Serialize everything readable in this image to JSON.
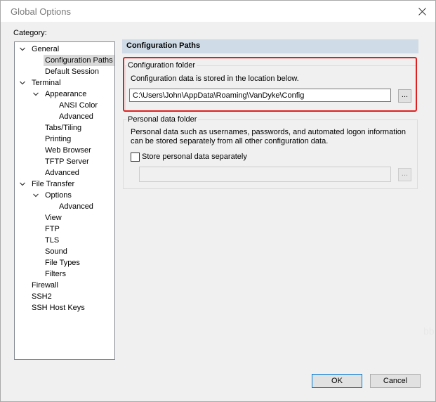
{
  "window": {
    "title": "Global Options"
  },
  "category_label": "Category:",
  "tree": {
    "items": [
      {
        "label": "General",
        "level": 0,
        "expanded": true
      },
      {
        "label": "Configuration Paths",
        "level": 1,
        "selected": true
      },
      {
        "label": "Default Session",
        "level": 1
      },
      {
        "label": "Terminal",
        "level": 0,
        "expanded": true
      },
      {
        "label": "Appearance",
        "level": 1,
        "expanded": true
      },
      {
        "label": "ANSI Color",
        "level": 2
      },
      {
        "label": "Advanced",
        "level": 2
      },
      {
        "label": "Tabs/Tiling",
        "level": 1
      },
      {
        "label": "Printing",
        "level": 1
      },
      {
        "label": "Web Browser",
        "level": 1
      },
      {
        "label": "TFTP Server",
        "level": 1
      },
      {
        "label": "Advanced",
        "level": 1
      },
      {
        "label": "File Transfer",
        "level": 0,
        "expanded": true
      },
      {
        "label": "Options",
        "level": 1,
        "expanded": true
      },
      {
        "label": "Advanced",
        "level": 2
      },
      {
        "label": "View",
        "level": 1
      },
      {
        "label": "FTP",
        "level": 1
      },
      {
        "label": "TLS",
        "level": 1
      },
      {
        "label": "Sound",
        "level": 1
      },
      {
        "label": "File Types",
        "level": 1
      },
      {
        "label": "Filters",
        "level": 1
      },
      {
        "label": "Firewall",
        "level": 0
      },
      {
        "label": "SSH2",
        "level": 0
      },
      {
        "label": "SSH Host Keys",
        "level": 0
      }
    ]
  },
  "panel": {
    "title": "Configuration Paths",
    "config_folder": {
      "title": "Configuration folder",
      "description": "Configuration data is stored in the location below.",
      "path_value": "C:\\Users\\John\\AppData\\Roaming\\VanDyke\\Config",
      "browse_label": "..."
    },
    "personal_folder": {
      "title": "Personal data folder",
      "description_line1": "Personal data such as usernames, passwords, and automated logon information",
      "description_line2": "can be stored separately from all other configuration data.",
      "checkbox_label": "Store personal data separately",
      "checkbox_checked": false,
      "path_value": "",
      "browse_label": "..."
    }
  },
  "buttons": {
    "ok": "OK",
    "cancel": "Cancel"
  },
  "watermark": "bb",
  "colors": {
    "highlight": "#e02020",
    "header_bg": "#cfdbe7",
    "selected_bg": "#d9d9d9"
  }
}
